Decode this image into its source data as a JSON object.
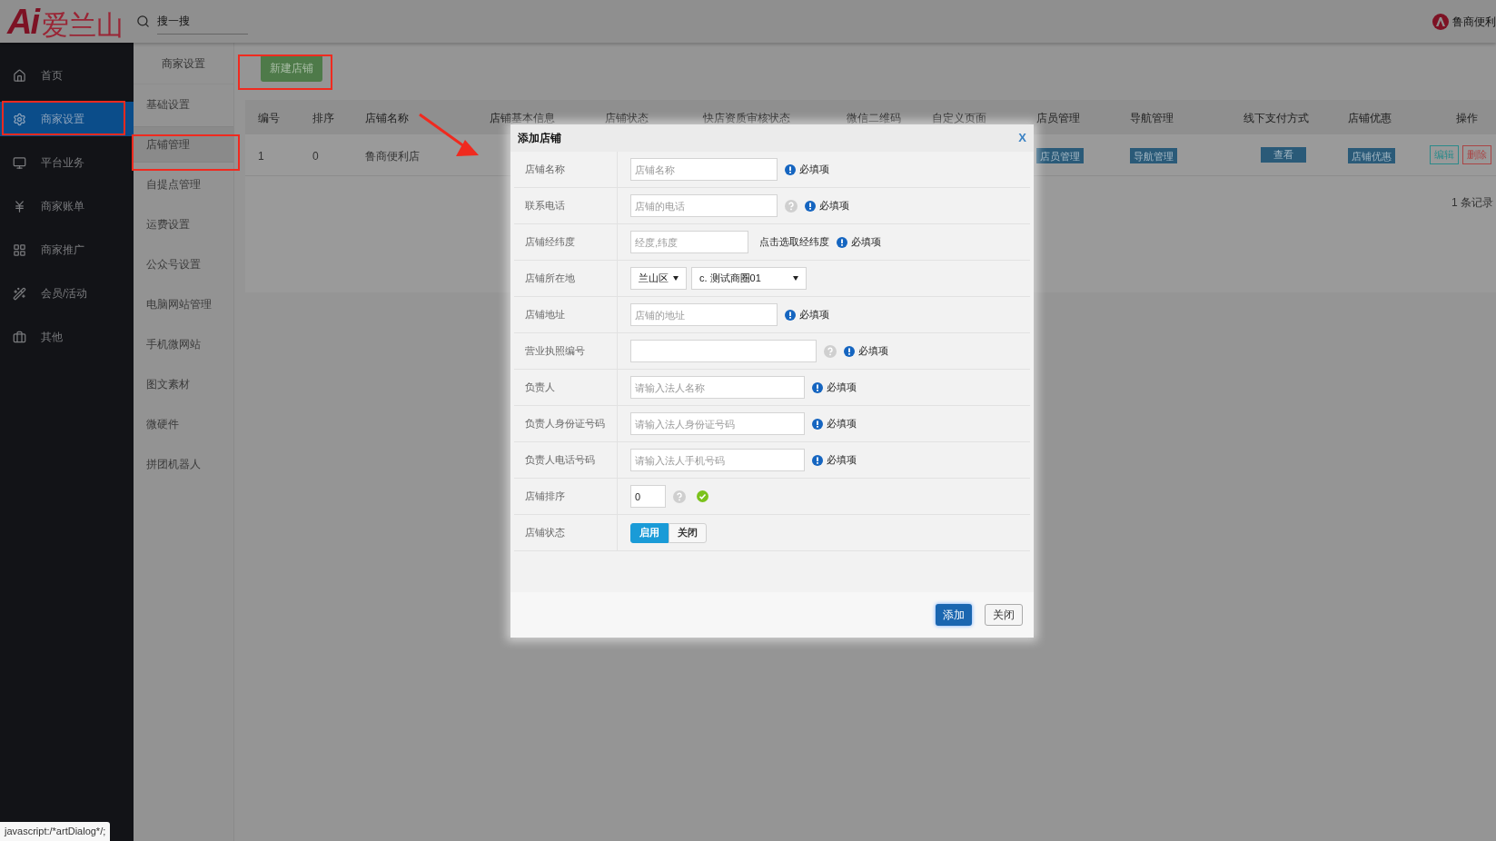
{
  "header": {
    "logo_mark": "Ai",
    "logo_name": "爱兰山",
    "search": {
      "placeholder": "搜一搜"
    },
    "user": "鲁商便利"
  },
  "sidebar": {
    "items": [
      {
        "label": "首页",
        "selected": false
      },
      {
        "label": "商家设置",
        "selected": true
      },
      {
        "label": "平台业务",
        "selected": false
      },
      {
        "label": "商家账单",
        "selected": false
      },
      {
        "label": "商家推广",
        "selected": false
      },
      {
        "label": "会员/活动",
        "selected": false
      },
      {
        "label": "其他",
        "selected": false
      }
    ]
  },
  "subnav": {
    "title": "商家设置",
    "items": [
      {
        "label": "基础设置",
        "selected": false
      },
      {
        "label": "店铺管理",
        "selected": true
      },
      {
        "label": "自提点管理",
        "selected": false
      },
      {
        "label": "运费设置",
        "selected": false
      },
      {
        "label": "公众号设置",
        "selected": false
      },
      {
        "label": "电脑网站管理",
        "selected": false
      },
      {
        "label": "手机微网站",
        "selected": false
      },
      {
        "label": "图文素材",
        "selected": false
      },
      {
        "label": "微硬件",
        "selected": false
      },
      {
        "label": "拼团机器人",
        "selected": false
      }
    ]
  },
  "new_button": "新建店铺",
  "table": {
    "columns": [
      "编号",
      "排序",
      "店铺名称",
      "店铺基本信息",
      "店铺状态",
      "快店资质审核状态",
      "微信二维码",
      "自定义页面",
      "店员管理",
      "导航管理",
      "线下支付方式",
      "店铺优惠",
      "操作"
    ],
    "rows": [
      {
        "id": "1",
        "sort": "0",
        "name": "鲁商便利店",
        "tags": [
          "店员管理",
          "导航管理",
          "查看",
          "店铺优惠"
        ],
        "actions": [
          {
            "label": "编辑",
            "kind": "edit"
          },
          {
            "label": "删除",
            "kind": "delete"
          }
        ]
      }
    ],
    "footer": "1 条记录"
  },
  "dialog": {
    "title": "添加店铺",
    "close": "X",
    "fields": [
      {
        "label": "店铺名称",
        "kind": "text",
        "placeholder": "店铺名称",
        "required": "必填项"
      },
      {
        "label": "联系电话",
        "kind": "text",
        "placeholder": "店铺的电话",
        "help": true,
        "required": "必填项"
      },
      {
        "label": "店铺经纬度",
        "kind": "text",
        "placeholder": "经度,纬度",
        "link": "点击选取经纬度",
        "required": "必填项"
      },
      {
        "label": "店铺所在地",
        "kind": "selects",
        "selects": [
          "兰山区",
          "c. 测试商圈01"
        ]
      },
      {
        "label": "店铺地址",
        "kind": "text",
        "placeholder": "店铺的地址",
        "required": "必填项"
      },
      {
        "label": "营业执照编号",
        "kind": "text",
        "help": true,
        "required": "必填项"
      },
      {
        "label": "负责人",
        "kind": "text",
        "placeholder": "请输入法人名称",
        "required": "必填项"
      },
      {
        "label": "负责人身份证号码",
        "kind": "text",
        "placeholder": "请输入法人身份证号码",
        "required": "必填项"
      },
      {
        "label": "负责人电话号码",
        "kind": "text",
        "placeholder": "请输入法人手机号码",
        "required": "必填项"
      },
      {
        "label": "店铺排序",
        "kind": "text",
        "value": "0",
        "help": true,
        "valid": true
      },
      {
        "label": "店铺状态",
        "kind": "toggle",
        "options": [
          {
            "label": "启用",
            "selected": true
          },
          {
            "label": "关闭",
            "selected": false
          }
        ]
      }
    ],
    "buttons": [
      {
        "label": "添加",
        "kind": "primary"
      },
      {
        "label": "关闭",
        "kind": "default"
      }
    ]
  },
  "status_tip": "javascript:/*artDialog*/;"
}
